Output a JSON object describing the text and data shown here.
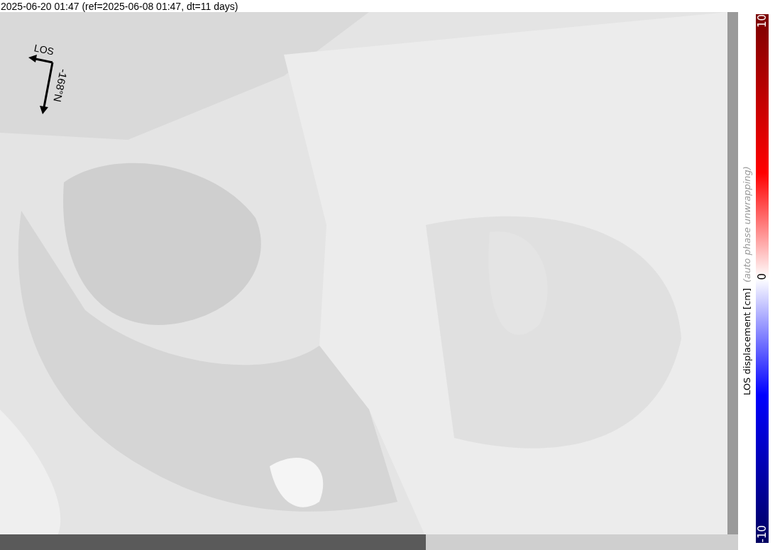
{
  "title": "2025-06-20 01:47 (ref=2025-06-08 01:47, dt=11 days)",
  "map": {
    "kind": "picture",
    "los_label": "LOS",
    "heading_label": "-168°N"
  },
  "colorbar": {
    "label": "LOS displacement [cm]",
    "note": "(auto phase unwrapping)",
    "max_label": "10",
    "zero_label": "0",
    "min_label": "-10"
  }
}
